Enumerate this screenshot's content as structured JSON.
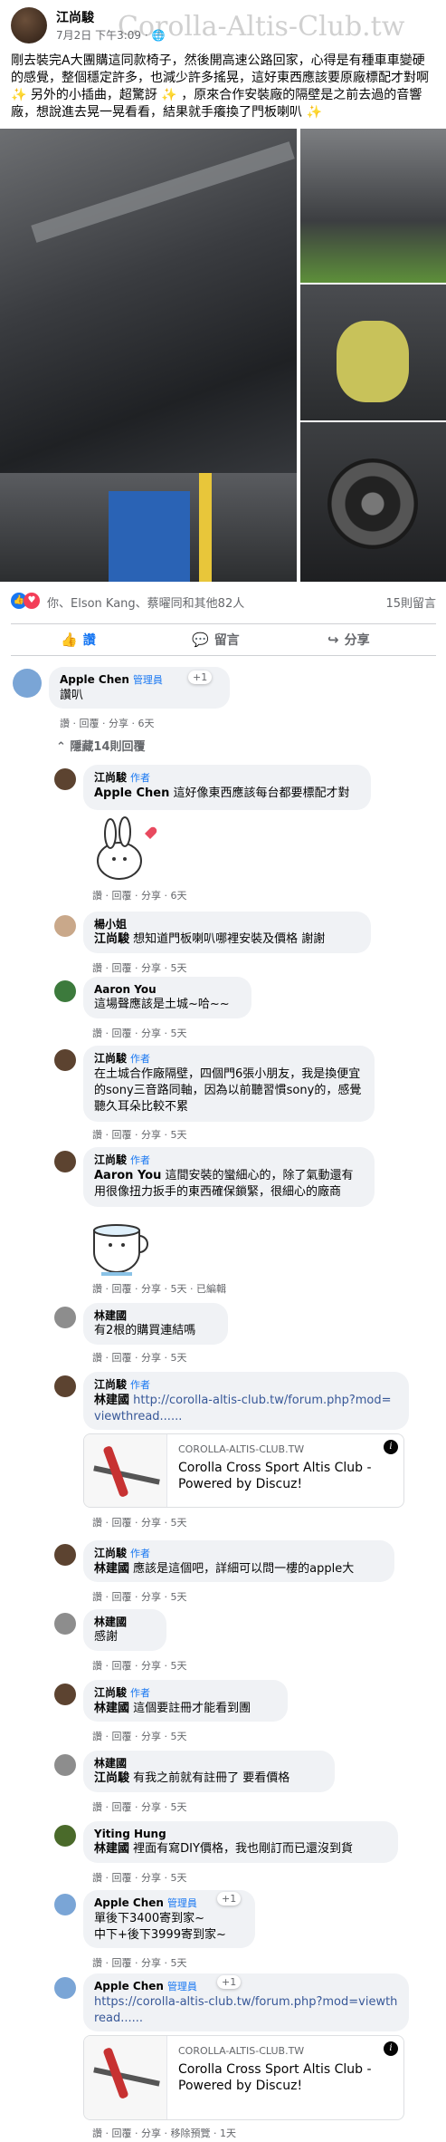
{
  "post": {
    "author": "江尚駿",
    "timestamp": "7月2日 下午3:09 · ",
    "watermark": "Corolla-Altis-Club.tw",
    "text": "剛去裝完A大團購這同款椅子，然後開高速公路回家，心得是有種車車變硬的感覺，整個穩定許多，也減少許多搖晃，這好東西應該要原廠標配才對啊 ✨ 另外的小插曲，超驚訝 ✨ ，原來合作安裝廠的隔壁是之前去過的音響廠，想說進去晃一晃看看，結果就手癢換了門板喇叭 ✨"
  },
  "reactions": {
    "like_icon": "like-icon",
    "love_icon": "love-icon",
    "summary": "你、Elson Kang、蔡曜同和其他82人",
    "comments": "15則留言"
  },
  "actions": {
    "like": "讚",
    "comment": "留言",
    "share": "分享"
  },
  "comments": [
    {
      "name": "Apple Chen",
      "badge": "管理員",
      "chip": "+1",
      "text": "讚叭",
      "meta": "讚 · 回覆 · 分享 · 6天"
    },
    {
      "toggle": "隱藏14則回覆"
    },
    {
      "name": "江尚駿",
      "badge": "作者",
      "mention": "Apple Chen",
      "text": "這好像東西應該每台都要標配才對",
      "meta": "讚 · 回覆 · 分享 · 6天"
    },
    {
      "name": "楊小姐",
      "mention": "江尚駿",
      "text": "想知道門板喇叭哪裡安裝及價格 謝謝",
      "meta": "讚 · 回覆 · 分享 · 5天"
    },
    {
      "name": "Aaron You",
      "text": "這場聲應該是土城~哈~~",
      "meta": "讚 · 回覆 · 分享 · 5天"
    },
    {
      "name": "江尚駿",
      "badge": "作者",
      "text": "在土城合作廠隔壁，四個門6張小朋友，我是換便宜的sony三音路同軸，因為以前聽習慣sony的，感覺聽久耳朵比較不累",
      "meta": "讚 · 回覆 · 分享 · 5天"
    },
    {
      "name": "江尚駿",
      "badge": "作者",
      "mention": "Aaron You",
      "text": "這間安裝的蠻細心的，除了氣動還有用很像扭力扳手的東西確保鎖緊，很細心的廠商",
      "meta": "讚 · 回覆 · 分享 · 5天 · 已編輯"
    },
    {
      "name": "林建國",
      "text": "有2根的購買連結嗎",
      "meta": "讚 · 回覆 · 分享 · 5天"
    },
    {
      "name": "江尚駿",
      "badge": "作者",
      "mention": "林建國",
      "link": "http://corolla-altis-club.tw/forum.php?mod=viewthread......",
      "card_domain": "COROLLA-ALTIS-CLUB.TW",
      "card_title": "Corolla Cross Sport Altis Club - Powered by Discuz!",
      "meta": "讚 · 回覆 · 分享 · 5天"
    },
    {
      "name": "江尚駿",
      "badge": "作者",
      "mention": "林建國",
      "text": "應該是這個吧，詳細可以問一樓的apple大",
      "meta": "讚 · 回覆 · 分享 · 5天"
    },
    {
      "name": "林建國",
      "text": "感謝",
      "meta": "讚 · 回覆 · 分享 · 5天"
    },
    {
      "name": "江尚駿",
      "badge": "作者",
      "mention": "林建國",
      "text": "這個要註冊才能看到團",
      "meta": "讚 · 回覆 · 分享 · 5天"
    },
    {
      "name": "林建國",
      "mention": "江尚駿",
      "text": "有我之前就有註冊了 要看價格",
      "meta": "讚 · 回覆 · 分享 · 5天"
    },
    {
      "name": "Yiting Hung",
      "mention": "林建國",
      "text": "裡面有寫DIY價格，我也剛訂而已還沒到貨",
      "meta": "讚 · 回覆 · 分享 · 5天"
    },
    {
      "name": "Apple Chen",
      "badge": "管理員",
      "chip": "+1",
      "text": "單後下3400寄到家~",
      "text2": "中下+後下3999寄到家~",
      "meta": "讚 · 回覆 · 分享 · 5天"
    },
    {
      "name": "Apple Chen",
      "badge": "管理員",
      "chip": "+1",
      "link": "https://corolla-altis-club.tw/forum.php?mod=viewthread......",
      "card_domain": "COROLLA-ALTIS-CLUB.TW",
      "card_title": "Corolla Cross Sport Altis Club - Powered by Discuz!",
      "meta": "讚 · 回覆 · 分享 · 移除預覽 · 1天"
    }
  ]
}
